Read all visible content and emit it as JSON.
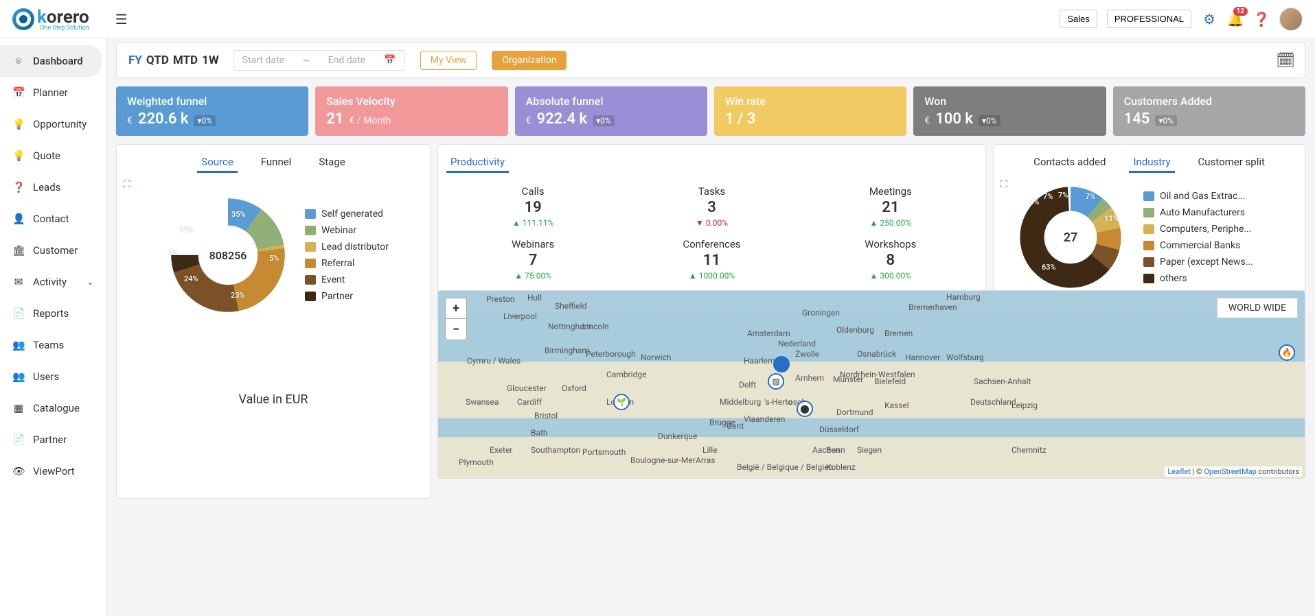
{
  "logo": {
    "text_black": "k",
    "text_rest": "orero",
    "tagline": "One Step Solution"
  },
  "header": {
    "sales_btn": "Sales",
    "plan_btn": "PROFESSIONAL",
    "notif_count": "12"
  },
  "sidebar": {
    "items": [
      {
        "icon": "⌾",
        "label": "Dashboard",
        "active": true
      },
      {
        "icon": "📅",
        "label": "Planner"
      },
      {
        "icon": "💡",
        "label": "Opportunity"
      },
      {
        "icon": "💡",
        "label": "Quote"
      },
      {
        "icon": "❓",
        "label": "Leads"
      },
      {
        "icon": "👤",
        "label": "Contact"
      },
      {
        "icon": "🏛",
        "label": "Customer"
      },
      {
        "icon": "✉",
        "label": "Activity",
        "chev": true
      },
      {
        "icon": "📄",
        "label": "Reports"
      },
      {
        "icon": "👥",
        "label": "Teams"
      },
      {
        "icon": "👥",
        "label": "Users"
      },
      {
        "icon": "▦",
        "label": "Catalogue"
      },
      {
        "icon": "📄",
        "label": "Partner"
      },
      {
        "icon": "👁",
        "label": "ViewPort"
      }
    ]
  },
  "toolbar": {
    "periods": [
      "FY",
      "QTD",
      "MTD",
      "1W"
    ],
    "start_ph": "Start date",
    "end_ph": "End date",
    "sep": "~",
    "myview": "My View",
    "org": "Organization"
  },
  "kpi": [
    {
      "title": "Weighted funnel",
      "currency": "€",
      "value": "220.6 k",
      "delta": "0%"
    },
    {
      "title": "Sales Velocity",
      "currency": "",
      "value": "21",
      "suffix": "€ / Month"
    },
    {
      "title": "Absolute funnel",
      "currency": "€",
      "value": "922.4 k",
      "delta": "0%"
    },
    {
      "title": "Win rate",
      "currency": "",
      "value": "1 / 3"
    },
    {
      "title": "Won",
      "currency": "€",
      "value": "100 k",
      "delta": "0%"
    },
    {
      "title": "Customers Added",
      "currency": "",
      "value": "145",
      "delta": "0%"
    }
  ],
  "source_panel": {
    "tabs": [
      "Source",
      "Funnel",
      "Stage"
    ],
    "active": 0,
    "center": "808256",
    "caption": "Value in EUR",
    "legend": [
      {
        "label": "Self generated",
        "color": "#5a9bd5"
      },
      {
        "label": "Webinar",
        "color": "#8faf76"
      },
      {
        "label": "Lead distributor",
        "color": "#d5b254"
      },
      {
        "label": "Referral",
        "color": "#c58a32"
      },
      {
        "label": "Event",
        "color": "#7b5227"
      },
      {
        "label": "Partner",
        "color": "#3d2914"
      }
    ]
  },
  "productivity": {
    "tab": "Productivity",
    "cells": [
      {
        "label": "Calls",
        "val": "19",
        "delta": "111.11%",
        "dir": "up"
      },
      {
        "label": "Tasks",
        "val": "3",
        "delta": "0.00%",
        "dir": "down"
      },
      {
        "label": "Meetings",
        "val": "21",
        "delta": "250.00%",
        "dir": "up"
      },
      {
        "label": "Webinars",
        "val": "7",
        "delta": "75.00%",
        "dir": "up"
      },
      {
        "label": "Conferences",
        "val": "11",
        "delta": "1000.00%",
        "dir": "up"
      },
      {
        "label": "Workshops",
        "val": "8",
        "delta": "300.00%",
        "dir": "up"
      }
    ]
  },
  "industry_panel": {
    "tabs": [
      "Contacts added",
      "Industry",
      "Customer split"
    ],
    "active": 1,
    "center": "27",
    "legend": [
      {
        "label": "Oil and Gas Extrac...",
        "color": "#5a9bd5"
      },
      {
        "label": "Auto Manufacturers",
        "color": "#8faf76"
      },
      {
        "label": "Computers, Periphe...",
        "color": "#d5b254"
      },
      {
        "label": "Commercial Banks",
        "color": "#c58a32"
      },
      {
        "label": "Paper (except News...",
        "color": "#7b5227"
      },
      {
        "label": "others",
        "color": "#3d2914"
      }
    ]
  },
  "map": {
    "tag": "WORLD WIDE",
    "attr_leaflet": "Leaflet",
    "attr_sep": " | © ",
    "attr_osm": "OpenStreetMap",
    "attr_tail": " contributors",
    "cities": [
      "Preston",
      "Hull",
      "Sheffield",
      "Liverpool",
      "Nottingham",
      "Lincoln",
      "Birmingham",
      "Peterborough",
      "Norwich",
      "Cambridge",
      "Gloucester",
      "Oxford",
      "London",
      "Swansea",
      "Cardiff",
      "Bristol",
      "Bath",
      "Exeter",
      "Southampton",
      "Portsmouth",
      "Plymouth",
      "Amsterdam",
      "Groningen",
      "Bremerhaven",
      "Oldenburg",
      "Bremen",
      "Hamburg",
      "Haarlem",
      "Nederland",
      "Zwolle",
      "Osnabrück",
      "Hannover",
      "Wolfsburg",
      "Delft",
      "Arnhem",
      "Münster",
      "Bielefeld",
      "Sachsen-Anhalt",
      "Middelburg",
      "'s-Herto",
      "osch",
      "Dortmund",
      "Kassel",
      "Deutschland",
      "Leipzig",
      "Brugge",
      "Gent",
      "Vlaanderen",
      "Düsseldorf",
      "Dunkerque",
      "Lille",
      "Aachen",
      "Bonn",
      "Siegen",
      "Chemnitz",
      "Boulogne-sur-Mer",
      "Arras",
      "België / Belgique / Belgien",
      "Koblenz",
      "Nordrhein-Westfalen",
      "Cymru / Wales"
    ]
  },
  "chart_data": [
    {
      "type": "pie",
      "title": "Source — Value in EUR",
      "center_value": 808256,
      "series": [
        {
          "name": "Self generated",
          "percent": 35
        },
        {
          "name": "Webinar",
          "percent": 12
        },
        {
          "name": "Lead distributor",
          "percent": 1
        },
        {
          "name": "Referral",
          "percent": 24
        },
        {
          "name": "Event",
          "percent": 23
        },
        {
          "name": "Partner",
          "percent": 5
        }
      ]
    },
    {
      "type": "pie",
      "title": "Industry",
      "center_value": 27,
      "series": [
        {
          "name": "Oil and Gas Extraction",
          "percent": 11
        },
        {
          "name": "Auto Manufacturers",
          "percent": 4
        },
        {
          "name": "Computers, Peripherals",
          "percent": 7
        },
        {
          "name": "Commercial Banks",
          "percent": 7
        },
        {
          "name": "Paper (except Newspaper)",
          "percent": 7
        },
        {
          "name": "others",
          "percent": 63
        }
      ]
    }
  ]
}
